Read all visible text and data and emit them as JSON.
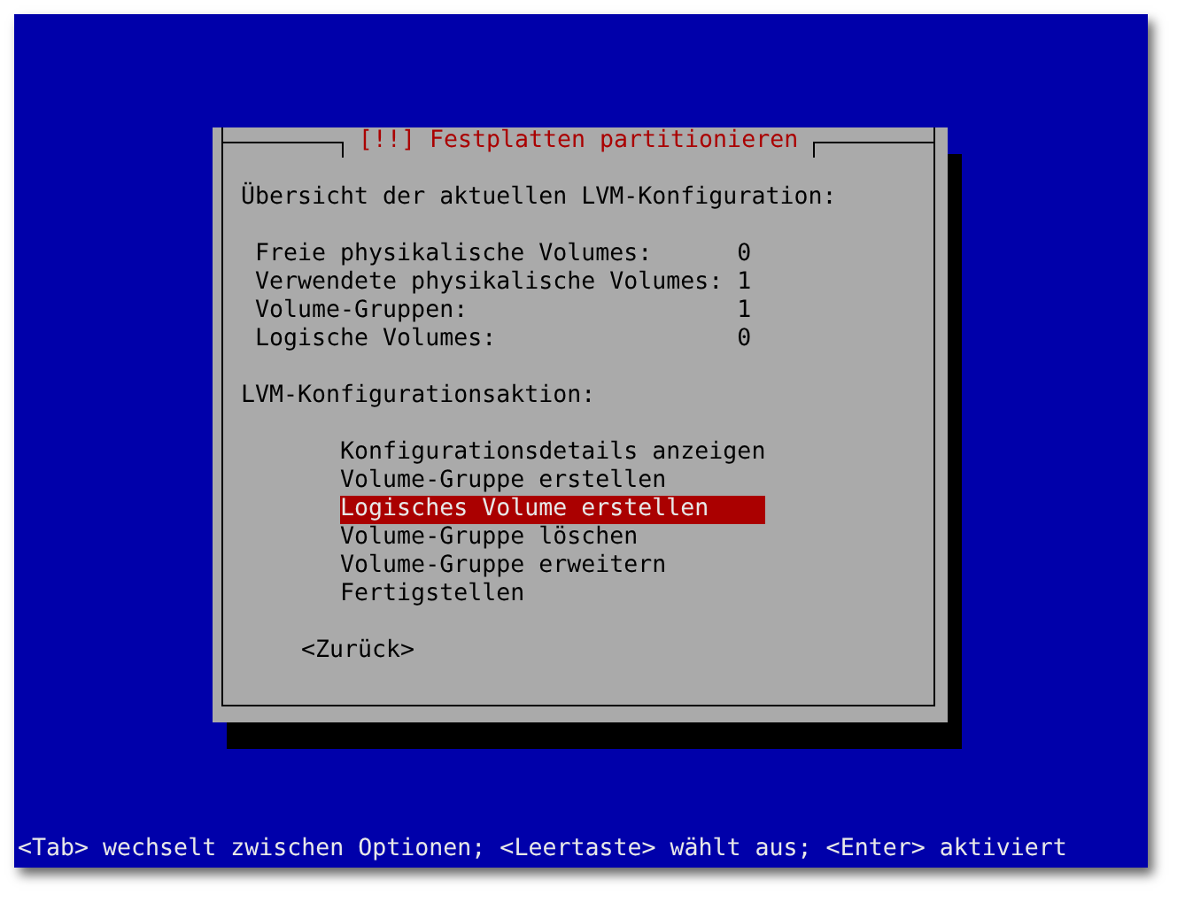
{
  "dialog": {
    "title": "[!!] Festplatten partitionieren",
    "heading": "Übersicht der aktuellen LVM-Konfiguration:",
    "stats": [
      {
        "label": "Freie physikalische Volumes:",
        "value": "0"
      },
      {
        "label": "Verwendete physikalische Volumes:",
        "value": "1"
      },
      {
        "label": "Volume-Gruppen:",
        "value": "1"
      },
      {
        "label": "Logische Volumes:",
        "value": "0"
      }
    ],
    "menu_label": "LVM-Konfigurationsaktion:",
    "menu": [
      {
        "label": "Konfigurationsdetails anzeigen",
        "selected": false
      },
      {
        "label": "Volume-Gruppe erstellen",
        "selected": false
      },
      {
        "label": "Logisches Volume erstellen",
        "selected": true
      },
      {
        "label": "Volume-Gruppe löschen",
        "selected": false
      },
      {
        "label": "Volume-Gruppe erweitern",
        "selected": false
      },
      {
        "label": "Fertigstellen",
        "selected": false
      }
    ],
    "back_button": "<Zurück>"
  },
  "status_bar": "<Tab> wechselt zwischen Optionen; <Leertaste> wählt aus; <Enter> aktiviert"
}
